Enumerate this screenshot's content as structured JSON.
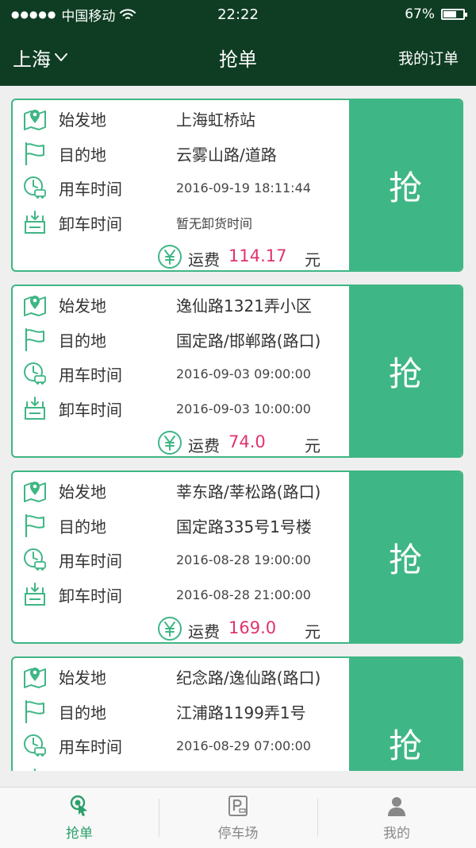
{
  "status_bar": {
    "signal": "●●●●●",
    "carrier": "中国移动",
    "time": "22:22",
    "battery": "67%"
  },
  "nav": {
    "city": "上海",
    "title": "抢单",
    "my_orders": "我的订单"
  },
  "labels": {
    "origin": "始发地",
    "destination": "目的地",
    "use_time": "用车时间",
    "unload_time": "卸车时间",
    "fee": "运费",
    "unit": "元",
    "grab": "抢"
  },
  "orders": [
    {
      "origin": "上海虹桥站",
      "destination": "云雾山路/道路",
      "use_time": "2016-09-19 18:11:44",
      "unload_time": "暂无卸货时间",
      "fee": "114.17"
    },
    {
      "origin": "逸仙路1321弄小区",
      "destination": "国定路/邯郸路(路口)",
      "use_time": "2016-09-03 09:00:00",
      "unload_time": "2016-09-03 10:00:00",
      "fee": "74.0"
    },
    {
      "origin": "莘东路/莘松路(路口)",
      "destination": "国定路335号1号楼",
      "use_time": "2016-08-28 19:00:00",
      "unload_time": "2016-08-28 21:00:00",
      "fee": "169.0"
    },
    {
      "origin": "纪念路/逸仙路(路口)",
      "destination": "江浦路1199弄1号",
      "use_time": "2016-08-29 07:00:00"
    }
  ],
  "tabs": [
    {
      "label": "抢单",
      "icon": "grab-order-icon",
      "active": true
    },
    {
      "label": "停车场",
      "icon": "parking-icon",
      "active": false
    },
    {
      "label": "我的",
      "icon": "profile-icon",
      "active": false
    }
  ],
  "colors": {
    "header_bg": "#0f3d23",
    "accent": "#3fb685",
    "fee": "#e0336d"
  }
}
